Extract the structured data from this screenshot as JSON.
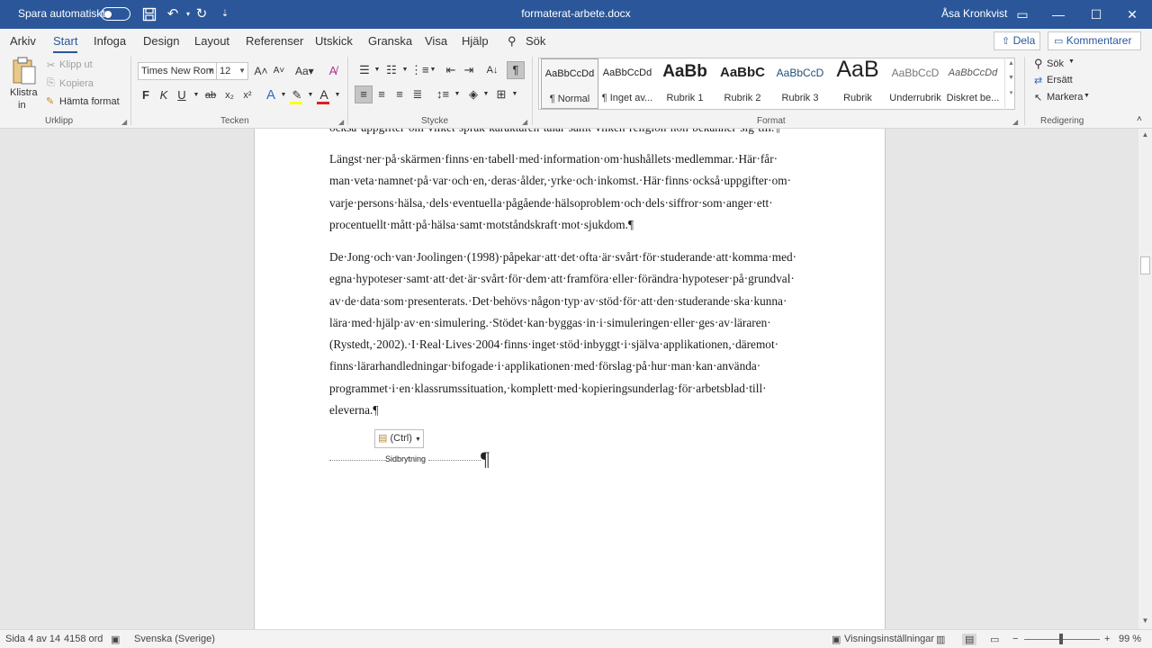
{
  "titlebar": {
    "autosave_label": "Spara automatiskt",
    "document_title": "formaterat-arbete.docx",
    "user_name": "Åsa Kronkvist"
  },
  "menu": {
    "tabs": [
      "Arkiv",
      "Start",
      "Infoga",
      "Design",
      "Layout",
      "Referenser",
      "Utskick",
      "Granska",
      "Visa",
      "Hjälp"
    ],
    "search_label": "Sök",
    "share_label": "Dela",
    "comments_label": "Kommentarer"
  },
  "ribbon": {
    "clipboard": {
      "paste_line1": "Klistra",
      "paste_line2": "in",
      "cut": "Klipp ut",
      "copy": "Kopiera",
      "format_painter": "Hämta format",
      "group_label": "Urklipp"
    },
    "font": {
      "font_name": "Times New Rom",
      "font_size": "12",
      "bold": "F",
      "italic": "K",
      "underline": "U",
      "group_label": "Tecken"
    },
    "paragraph": {
      "group_label": "Stycke"
    },
    "styles": {
      "items": [
        {
          "sample": "AaBbCcDd",
          "name": "¶ Normal"
        },
        {
          "sample": "AaBbCcDd",
          "name": "¶ Inget av..."
        },
        {
          "sample": "AaBb",
          "name": "Rubrik 1"
        },
        {
          "sample": "AaBbC",
          "name": "Rubrik 2"
        },
        {
          "sample": "AaBbCcD",
          "name": "Rubrik 3"
        },
        {
          "sample": "AaB",
          "name": "Rubrik"
        },
        {
          "sample": "AaBbCcD",
          "name": "Underrubrik"
        },
        {
          "sample": "AaBbCcDd",
          "name": "Diskret be..."
        }
      ],
      "group_label": "Format"
    },
    "editing": {
      "find": "Sök",
      "replace": "Ersätt",
      "select": "Markera",
      "group_label": "Redigering"
    }
  },
  "document": {
    "para0": [
      "också·uppgifter·om·vilket·språk·karaktären·talar·samt·vilken·religion·hon·bekänner·sig·till.¶"
    ],
    "para1": [
      "Längst·ner·på·skärmen·finns·en·tabell·med·information·om·hushållets·medlemmar.·Här·får·",
      "man·veta·namnet·på·var·och·en,·deras·ålder,·yrke·och·inkomst.·Här·finns·också·uppgifter·om·",
      "varje·persons·hälsa,·dels·eventuella·pågående·hälsoproblem·och·dels·siffror·som·anger·ett·",
      "procentuellt·mått·på·hälsa·samt·motståndskraft·mot·sjukdom.¶"
    ],
    "para2": [
      "De·Jong·och·van·Joolingen·(1998)·påpekar·att·det·ofta·är·svårt·för·studerande·att·komma·med·",
      "egna·hypoteser·samt·att·det·är·svårt·för·dem·att·framföra·eller·förändra·hypoteser·på·grundval·",
      "av·de·data·som·presenterats.·Det·behövs·någon·typ·av·stöd·för·att·den·studerande·ska·kunna·",
      "lära·med·hjälp·av·en·simulering.·Stödet·kan·byggas·in·i·simuleringen·eller·ges·av·läraren·",
      "(Rystedt,·2002).·I·Real·Lives·2004·finns·inget·stöd·inbyggt·i·själva·applikationen,·däremot·",
      "finns·lärarhandledningar·bifogade·i·applikationen·med·förslag·på·hur·man·kan·använda·",
      "programmet·i·en·klassrumssituation,·komplett·med·kopieringsunderlag·för·arbetsblad·till·",
      "eleverna.¶"
    ],
    "paste_options_label": "(Ctrl)",
    "page_break_label": "Sidbrytning",
    "pilcrow": "¶"
  },
  "status": {
    "page": "Sida 4 av 14",
    "words": "4158 ord",
    "language": "Svenska (Sverige)",
    "display_settings": "Visningsinställningar",
    "zoom": "99 %"
  },
  "colors": {
    "titlebar": "#2b579a",
    "accent": "#2b579a"
  }
}
